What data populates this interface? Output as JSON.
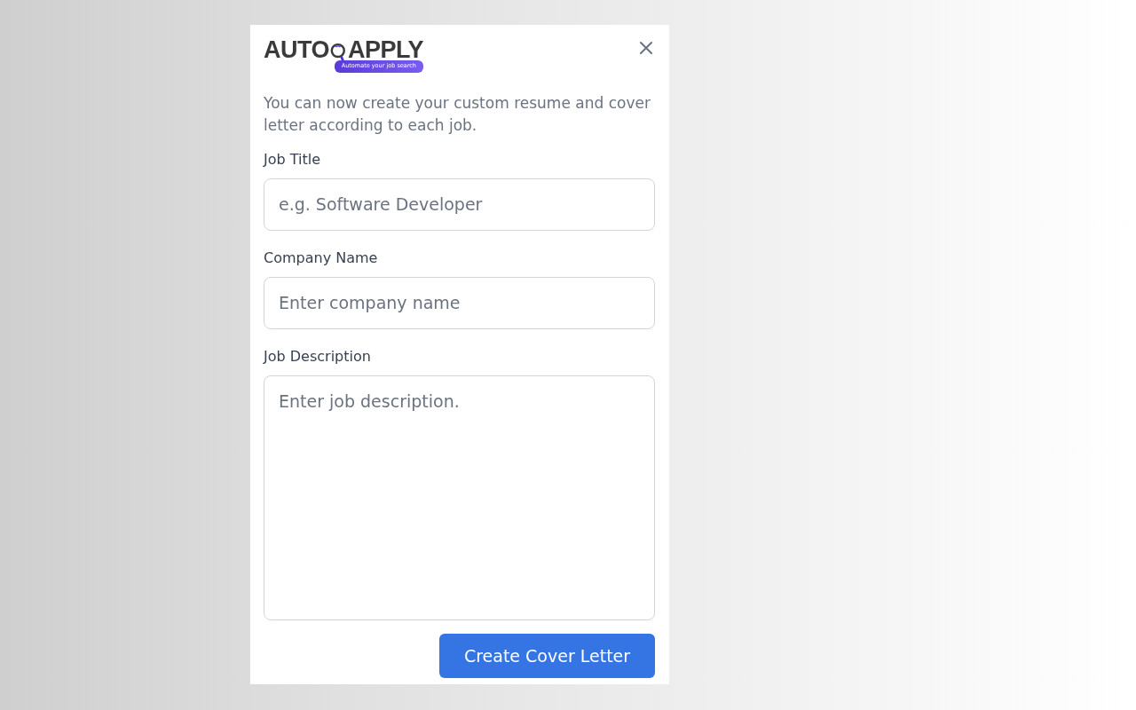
{
  "logo": {
    "word_1": "AUTO",
    "word_2": "APPLY",
    "tagline": "Automate your job search"
  },
  "intro": "You can now create your custom resume and cover letter according to each job.",
  "fields": [
    {
      "kind": "input",
      "label": "Job Title",
      "placeholder": "e.g. Software Developer"
    },
    {
      "kind": "input",
      "label": "Company Name",
      "placeholder": "Enter company name"
    },
    {
      "kind": "textarea",
      "label": "Job Description",
      "placeholder": "Enter job description."
    }
  ],
  "submit": "Create Cover Letter"
}
